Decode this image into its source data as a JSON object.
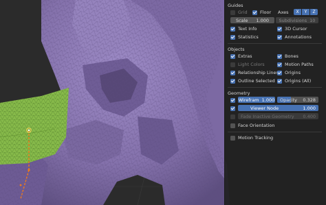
{
  "guides": {
    "title": "Guides",
    "grid": "Grid",
    "floor": "Floor",
    "axes": "Axes",
    "axis_x": "X",
    "axis_y": "Y",
    "axis_z": "Z",
    "scale_label": "Scale",
    "scale_value": "1.000",
    "subdivisions_label": "Subdivisions",
    "subdivisions_value": "10",
    "text_info": "Text Info",
    "cursor_3d": "3D Cursor",
    "statistics": "Statistics",
    "annotations": "Annotations"
  },
  "objects": {
    "title": "Objects",
    "extras": "Extras",
    "bones": "Bones",
    "light_colors": "Light Colors",
    "motion_paths": "Motion Paths",
    "relationship_lines": "Relationship Lines",
    "origins": "Origins",
    "outline_selected": "Outline Selected",
    "origins_all": "Origins (All)"
  },
  "geometry": {
    "title": "Geometry",
    "wireframe_label": "Wirefram",
    "wireframe_value": "1.000",
    "opacity_label": "Opacity",
    "opacity_value": "0.328",
    "opacity_level": 0.328,
    "viewer_node_label": "Viewer Node",
    "viewer_node_value": "1.000",
    "fade_inactive_label": "Fade Inactive Geometry",
    "fade_inactive_value": "0.400",
    "face_orientation": "Face Orientation",
    "motion_tracking": "Motion Tracking"
  },
  "colors": {
    "accent": "#4772b3",
    "panel_bg": "#222222",
    "mesh": "#8a77b3",
    "selection": "#86b94a",
    "bone": "#f07a1a"
  }
}
